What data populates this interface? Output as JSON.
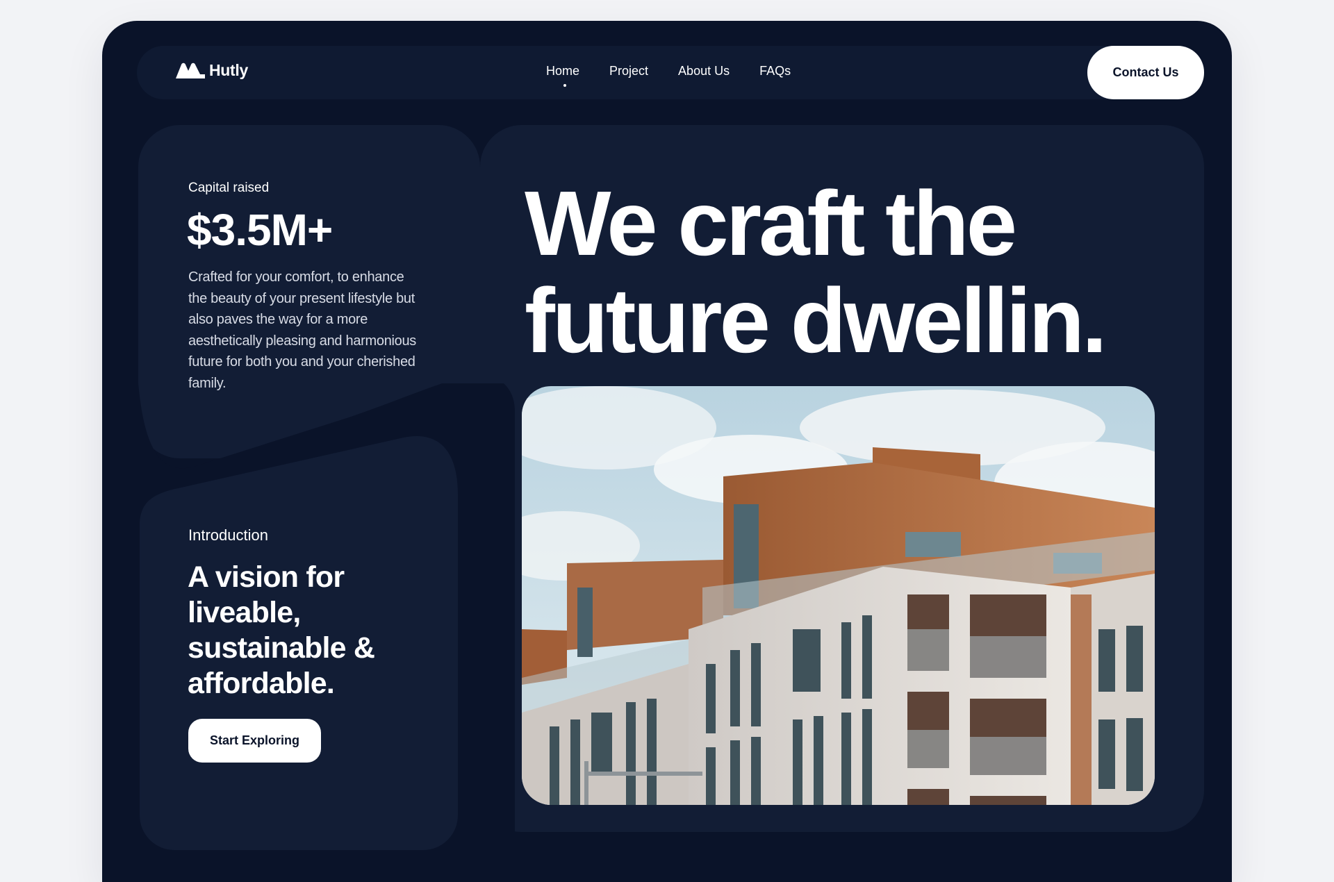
{
  "brand": {
    "name": "Hutly"
  },
  "nav": {
    "items": [
      {
        "label": "Home",
        "active": true
      },
      {
        "label": "Project",
        "active": false
      },
      {
        "label": "About Us",
        "active": false
      },
      {
        "label": "FAQs",
        "active": false
      }
    ],
    "cta_label": "Contact Us"
  },
  "stats": {
    "label": "Capital raised",
    "value": "$3.5M+",
    "description": "Crafted for your comfort, to enhance the beauty of your present lifestyle but also paves the way for a more aesthetically pleasing and harmonious future for both you and your cherished family."
  },
  "intro": {
    "label": "Introduction",
    "title": "A vision for liveable, sustainable & affordable.",
    "cta_label": "Start Exploring"
  },
  "hero": {
    "headline": "We craft the future dwellin."
  },
  "colors": {
    "background": "#0a1329",
    "panel": "#121d35",
    "accent": "#ffffff"
  }
}
